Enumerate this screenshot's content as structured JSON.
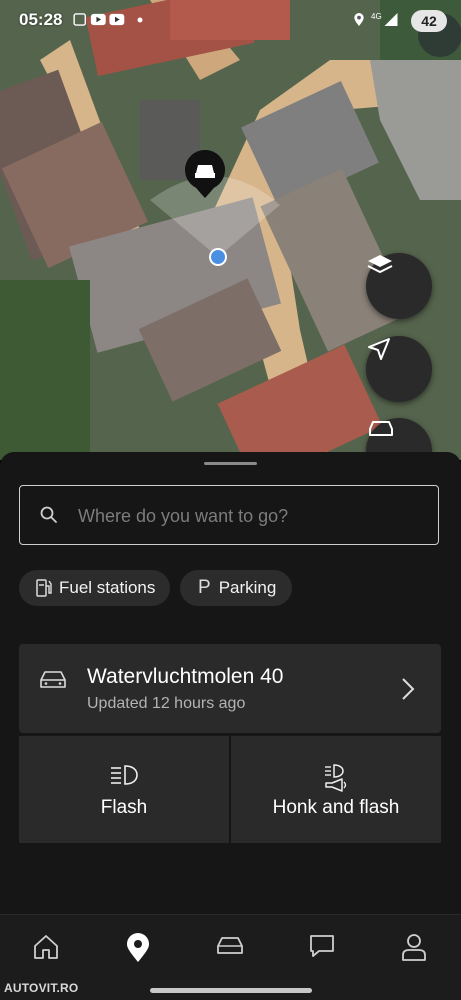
{
  "status_bar": {
    "time": "05:28",
    "battery": "42",
    "network": "4G"
  },
  "map": {
    "layers_icon": "layers-icon",
    "locate_icon": "navigation-arrow-icon",
    "car_icon": "car-icon"
  },
  "search": {
    "placeholder": "Where do you want to go?"
  },
  "chips": [
    {
      "label": "Fuel stations",
      "icon": "fuel-pump-icon"
    },
    {
      "label": "Parking",
      "icon": "parking-icon"
    }
  ],
  "vehicle": {
    "location": "Watervluchtmolen 40",
    "updated": "Updated 12 hours ago"
  },
  "actions": [
    {
      "label": "Flash",
      "icon": "headlight-icon"
    },
    {
      "label": "Honk and flash",
      "icon": "horn-headlight-icon"
    }
  ],
  "nav": [
    {
      "name": "home",
      "icon": "home-icon"
    },
    {
      "name": "map",
      "icon": "location-pin-icon",
      "active": true
    },
    {
      "name": "car",
      "icon": "car-icon"
    },
    {
      "name": "messages",
      "icon": "chat-icon"
    },
    {
      "name": "profile",
      "icon": "person-icon"
    }
  ],
  "watermark": "AUTOVIT.RO",
  "colors": {
    "sheet_bg": "#161616",
    "card_bg": "#2a2a2a",
    "chip_bg": "#2c2c2c",
    "location_dot": "#4a90e2"
  }
}
